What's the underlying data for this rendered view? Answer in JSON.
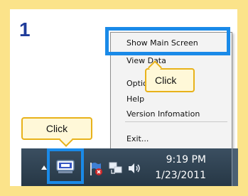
{
  "step": "1",
  "context_menu": {
    "items": [
      {
        "label": "Show Main Screen"
      },
      {
        "label": "View Data"
      },
      {
        "label": "Options"
      },
      {
        "label": "Help"
      },
      {
        "label": "Version Infomation"
      },
      {
        "label": "Exit..."
      }
    ]
  },
  "callouts": {
    "menu_click": "Click",
    "tray_click": "Click"
  },
  "taskbar": {
    "time": "9:19 PM",
    "date": "1/23/2011",
    "icons": [
      "show-hidden-icons-arrow-icon",
      "app-tray-icon",
      "action-center-flag-icon",
      "network-icon",
      "volume-icon"
    ]
  },
  "colors": {
    "highlight": "#1a8ae8",
    "callout_border": "#e8b21a",
    "frame": "#fbe38a",
    "step_number": "#1f3c9a"
  }
}
